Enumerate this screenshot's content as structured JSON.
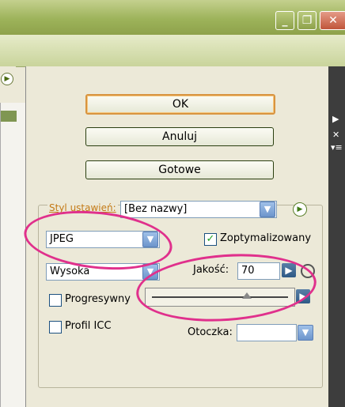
{
  "buttons": {
    "ok": "OK",
    "cancel": "Anuluj",
    "done": "Gotowe"
  },
  "preset": {
    "label": "Styl ustawień:",
    "value": "[Bez nazwy]"
  },
  "format": {
    "value": "JPEG"
  },
  "optimized": {
    "label": "Zoptymalizowany",
    "checked": true
  },
  "quality_preset": {
    "value": "Wysoka"
  },
  "quality": {
    "label": "Jakość:",
    "value": "70",
    "slider_fraction": 0.7
  },
  "progressive": {
    "label": "Progresywny",
    "checked": false
  },
  "icc": {
    "label": "Profil ICC",
    "checked": false
  },
  "matte": {
    "label": "Otoczka:",
    "value": ""
  },
  "annotation_color": "#e0308c",
  "icons": [
    "minimize-icon",
    "restore-icon",
    "close-icon",
    "menu-arrow-icon",
    "dropdown-arrow-icon",
    "checkmark-icon"
  ]
}
